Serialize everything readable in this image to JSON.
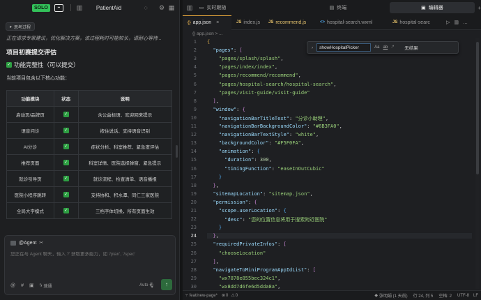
{
  "topbar": {
    "logo_text": "SOLO",
    "project_name": "PatientAid"
  },
  "chat": {
    "thinking_label": "思考过程",
    "intro": "正在请求专家建议，优化解决方案，该过程耗时可能较长，请耐心等待...",
    "section_title": "项目初赛提交评估",
    "check_title": "功能完整性（可以提交）",
    "core_text": "当前项目包含以下核心功能：",
    "table": {
      "headers": [
        "功能模块",
        "状态",
        "说明"
      ],
      "rows": [
        [
          "启动页/品牌页",
          "✓",
          "含公益标语、欢迎回来提示"
        ],
        [
          "语音问诊",
          "✓",
          "按住说话、支持语音识别"
        ],
        [
          "AI分诊",
          "✓",
          "症状分析、科室推荐、紧急度评估"
        ],
        [
          "推荐页面",
          "✓",
          "科室详情、医院选择弹窗、紧急提示"
        ],
        [
          "就诊引导页",
          "✓",
          "就诊流程、检查清单、语音播报"
        ],
        [
          "医院小程序跳转",
          "✓",
          "支持协和、积水潭、同仁三家医院"
        ],
        [
          "全局大字模式",
          "✓",
          "三档字体切换，所有页面生效"
        ]
      ]
    }
  },
  "agent": {
    "label": "@Agent",
    "placeholder": "您正在与 Agent 聊天，输入 '/' 获取更多能力，如 '/plan', '/spec'",
    "mode_label": "速通",
    "model_label": "Auto"
  },
  "right_tabs": [
    {
      "label": "实时跟随",
      "active": false
    },
    {
      "label": "终端",
      "active": false
    },
    {
      "label": "编辑器",
      "active": true
    }
  ],
  "file_tabs": [
    {
      "icon": "{}",
      "label": "app.json",
      "active": true
    },
    {
      "icon": "JS",
      "label": "index.js",
      "active": false
    },
    {
      "icon": "JS",
      "label": "recommend.js",
      "active": false
    },
    {
      "icon": "<>",
      "label": "hospital-search.wxml",
      "active": false
    },
    {
      "icon": "JS",
      "label": "hospital-searc",
      "active": false
    }
  ],
  "breadcrumb": "{} app.json > ...",
  "find": {
    "value": "showHospitalPicker",
    "case_label": "Aa",
    "word_label": "ab",
    "regex_label": ".*",
    "result": "无结果"
  },
  "code": {
    "current_line": 24,
    "lines": [
      {
        "n": 1,
        "html": "<span class='b1'>{</span>"
      },
      {
        "n": 2,
        "html": "  <span class='k'>\"pages\"</span><span class='p'>: </span><span class='b2'>[</span>"
      },
      {
        "n": 3,
        "html": "    <span class='str'>\"pages/splash/splash\"</span><span class='p'>,</span>"
      },
      {
        "n": 4,
        "html": "    <span class='str'>\"pages/index/index\"</span><span class='p'>,</span>"
      },
      {
        "n": 5,
        "html": "    <span class='str'>\"pages/recommend/recommend\"</span><span class='p'>,</span>"
      },
      {
        "n": 6,
        "html": "    <span class='str'>\"pages/hospital-search/hospital-search\"</span><span class='p'>,</span>"
      },
      {
        "n": 7,
        "html": "    <span class='str'>\"pages/visit-guide/visit-guide\"</span>"
      },
      {
        "n": 8,
        "html": "  <span class='b2'>]</span><span class='p'>,</span>"
      },
      {
        "n": 9,
        "html": "  <span class='k'>\"window\"</span><span class='p'>: </span><span class='b2'>{</span>"
      },
      {
        "n": 10,
        "html": "    <span class='k'>\"navigationBarTitleText\"</span><span class='p'>: </span><span class='str'>\"分诊小助理\"</span><span class='p'>,</span>"
      },
      {
        "n": 11,
        "html": "    <span class='k'>\"navigationBarBackgroundColor\"</span><span class='p'>: </span><span class='str'>\"#6B3FA0\"</span><span class='p'>,</span>"
      },
      {
        "n": 12,
        "html": "    <span class='k'>\"navigationBarTextStyle\"</span><span class='p'>: </span><span class='str'>\"white\"</span><span class='p'>,</span>"
      },
      {
        "n": 13,
        "html": "    <span class='k'>\"backgroundColor\"</span><span class='p'>: </span><span class='str'>\"#F5F0FA\"</span><span class='p'>,</span>"
      },
      {
        "n": 14,
        "html": "    <span class='k'>\"animation\"</span><span class='p'>: </span><span class='b3'>{</span>"
      },
      {
        "n": 15,
        "html": "      <span class='k'>\"duration\"</span><span class='p'>: </span><span class='s'>300</span><span class='p'>,</span>"
      },
      {
        "n": 16,
        "html": "      <span class='k'>\"timingFunction\"</span><span class='p'>: </span><span class='str'>\"easeInOutCubic\"</span>"
      },
      {
        "n": 17,
        "html": "    <span class='b3'>}</span>"
      },
      {
        "n": 18,
        "html": "  <span class='b2'>}</span><span class='p'>,</span>"
      },
      {
        "n": 19,
        "html": "  <span class='k'>\"sitemapLocation\"</span><span class='p'>: </span><span class='str'>\"sitemap.json\"</span><span class='p'>,</span>"
      },
      {
        "n": 20,
        "html": "  <span class='k'>\"permission\"</span><span class='p'>: </span><span class='b2'>{</span>"
      },
      {
        "n": 21,
        "html": "    <span class='k'>\"scope.userLocation\"</span><span class='p'>: </span><span class='b3'>{</span>"
      },
      {
        "n": 22,
        "html": "      <span class='k'>\"desc\"</span><span class='p'>: </span><span class='str'>\"您的位置信息将用于搜索附近医院\"</span>"
      },
      {
        "n": 23,
        "html": "    <span class='b3'>}</span>"
      },
      {
        "n": 24,
        "html": "  <span class='b2'>}</span><span class='p'>,</span>"
      },
      {
        "n": 25,
        "html": "  <span class='k'>\"requiredPrivateInfos\"</span><span class='p'>: </span><span class='b2'>[</span>"
      },
      {
        "n": 26,
        "html": "    <span class='str'>\"chooseLocation\"</span>"
      },
      {
        "n": 27,
        "html": "  <span class='b2'>]</span><span class='p'>,</span>"
      },
      {
        "n": 28,
        "html": "  <span class='k'>\"navigateToMiniProgramAppIdList\"</span><span class='p'>: </span><span class='b2'>[</span>"
      },
      {
        "n": 29,
        "html": "    <span class='str'>\"wx7878e855bec324c1\"</span><span class='p'>,</span>"
      },
      {
        "n": 30,
        "html": "    <span class='str'>\"wx8dd7d6fe6d5dda8a\"</span><span class='p'>,</span>"
      }
    ]
  },
  "statusbar": {
    "branch": "feat/new-page*",
    "errors": "0",
    "warnings": "0",
    "author": "张明娟 (1 天前)",
    "position": "行 24, 列 5",
    "spaces": "空格: 2",
    "encoding": "UTF-8",
    "eol": "LF"
  },
  "colors": {
    "accent_green": "#33c15a",
    "active_tab_border": "#e2a33a"
  }
}
